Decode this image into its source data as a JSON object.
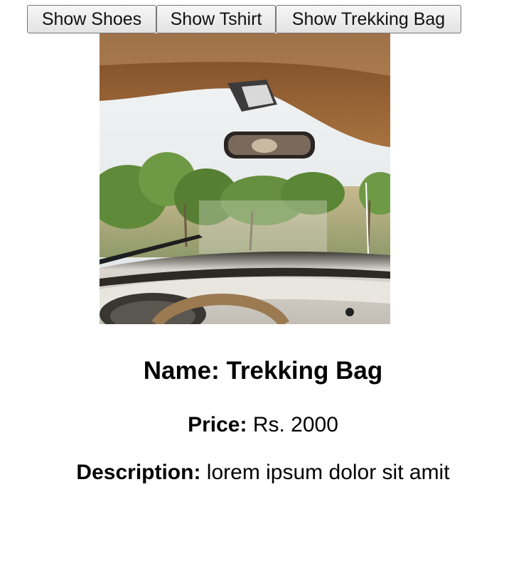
{
  "buttons": {
    "shoes": "Show Shoes",
    "tshirt": "Show Tshirt",
    "trekking_bag": "Show Trekking Bag"
  },
  "product": {
    "name_text": "Name: Trekking Bag",
    "price_label": "Price:",
    "price_value": "Rs. 2000",
    "description_label": "Description:",
    "description_value": "lorem ipsum dolor sit amit"
  },
  "colors": {
    "interior_brown": "#8a5a34",
    "sky": "#e9eef2",
    "foliage": "#5f8a3a",
    "dashboard": "#d8d6d0"
  }
}
